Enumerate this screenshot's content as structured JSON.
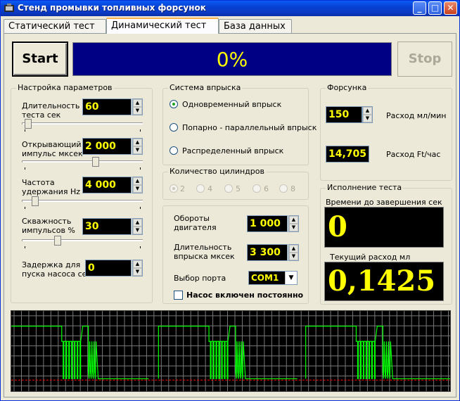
{
  "window": {
    "title": "Стенд промывки топливных форсунок",
    "min": "_",
    "max": "□",
    "close": "✕"
  },
  "tabs": [
    {
      "label": "Статический тест"
    },
    {
      "label": "Динамический тест"
    },
    {
      "label": "База данных"
    }
  ],
  "controls": {
    "start": "Start",
    "stop": "Stop",
    "progress": "0%",
    "progress_value": 0
  },
  "params": {
    "title": "Настройка параметров",
    "test_duration": {
      "label1": "Длительность",
      "label2": "теста сек",
      "value": "60"
    },
    "open_pulse": {
      "label1": "Открывающий",
      "label2": "импульс мксек",
      "value": "2 000"
    },
    "hold_freq": {
      "label1": "Частота",
      "label2": "удержания Hz",
      "value": "4 000"
    },
    "duty": {
      "label1": "Скважность",
      "label2": "импульсов %",
      "value": "30"
    },
    "pump_delay": {
      "label1": "Задержка для",
      "label2": "пуска насоса сек",
      "value": "0"
    }
  },
  "injection_system": {
    "title": "Система впрыска",
    "options": [
      "Одновременный впрыск",
      "Попарно - параллельный впрыск",
      "Распределенный впрыск"
    ],
    "selected": 0
  },
  "cylinders": {
    "title": "Количество цилиндров",
    "options": [
      "2",
      "4",
      "5",
      "6",
      "8"
    ],
    "selected": 0
  },
  "engine": {
    "rpm_label1": "Обороты",
    "rpm_label2": "двигателя",
    "rpm_value": "1 000",
    "inj_label1": "Длительность",
    "inj_label2": "впрыска мксек",
    "inj_value": "3 300",
    "port_label": "Выбор порта",
    "port_value": "COM1",
    "pump_label": "Насос включен постоянно"
  },
  "injector": {
    "title": "Форсунка",
    "flow_value": "150",
    "flow_label": "Расход мл/мин",
    "flow_ft_value": "14,705",
    "flow_ft_label": "Расход Ft/час"
  },
  "execution": {
    "title": "Исполнение теста",
    "remaining_label": "Времени до завершения сек",
    "remaining_value": "0",
    "current_label": "Текущий расход мл",
    "current_value": "0,1425"
  },
  "colors": {
    "display_bg": "#000000",
    "display_fg": "#ffff00",
    "progress_bg": "#000084",
    "signal": "#00ff00",
    "grid": "#7a7a7a",
    "baseline": "#ff0000"
  }
}
